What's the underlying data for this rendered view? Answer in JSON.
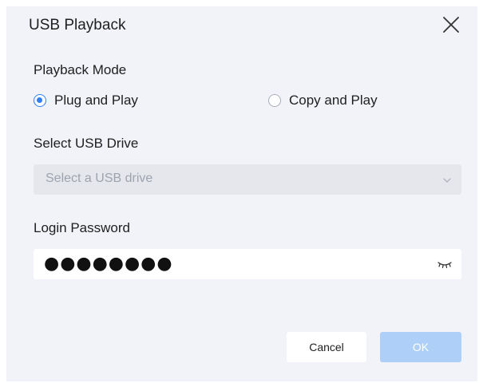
{
  "dialog": {
    "title": "USB Playback",
    "close_icon": "close-icon"
  },
  "playback_mode": {
    "label": "Playback Mode",
    "options": [
      {
        "label": "Plug and Play",
        "checked": true
      },
      {
        "label": "Copy and Play",
        "checked": false
      }
    ]
  },
  "usb_drive": {
    "label": "Select USB Drive",
    "placeholder": "Select a USB drive",
    "disabled": true,
    "icon": "chevron-down-icon"
  },
  "password": {
    "label": "Login Password",
    "masked_value": "●●●●●●●●",
    "icon": "eye-closed-icon"
  },
  "buttons": {
    "cancel": "Cancel",
    "ok": "OK",
    "ok_disabled": true
  },
  "colors": {
    "accent": "#2f7ef7",
    "ok_disabled_bg": "#aed0f8",
    "dialog_bg": "#f1f3f8"
  }
}
